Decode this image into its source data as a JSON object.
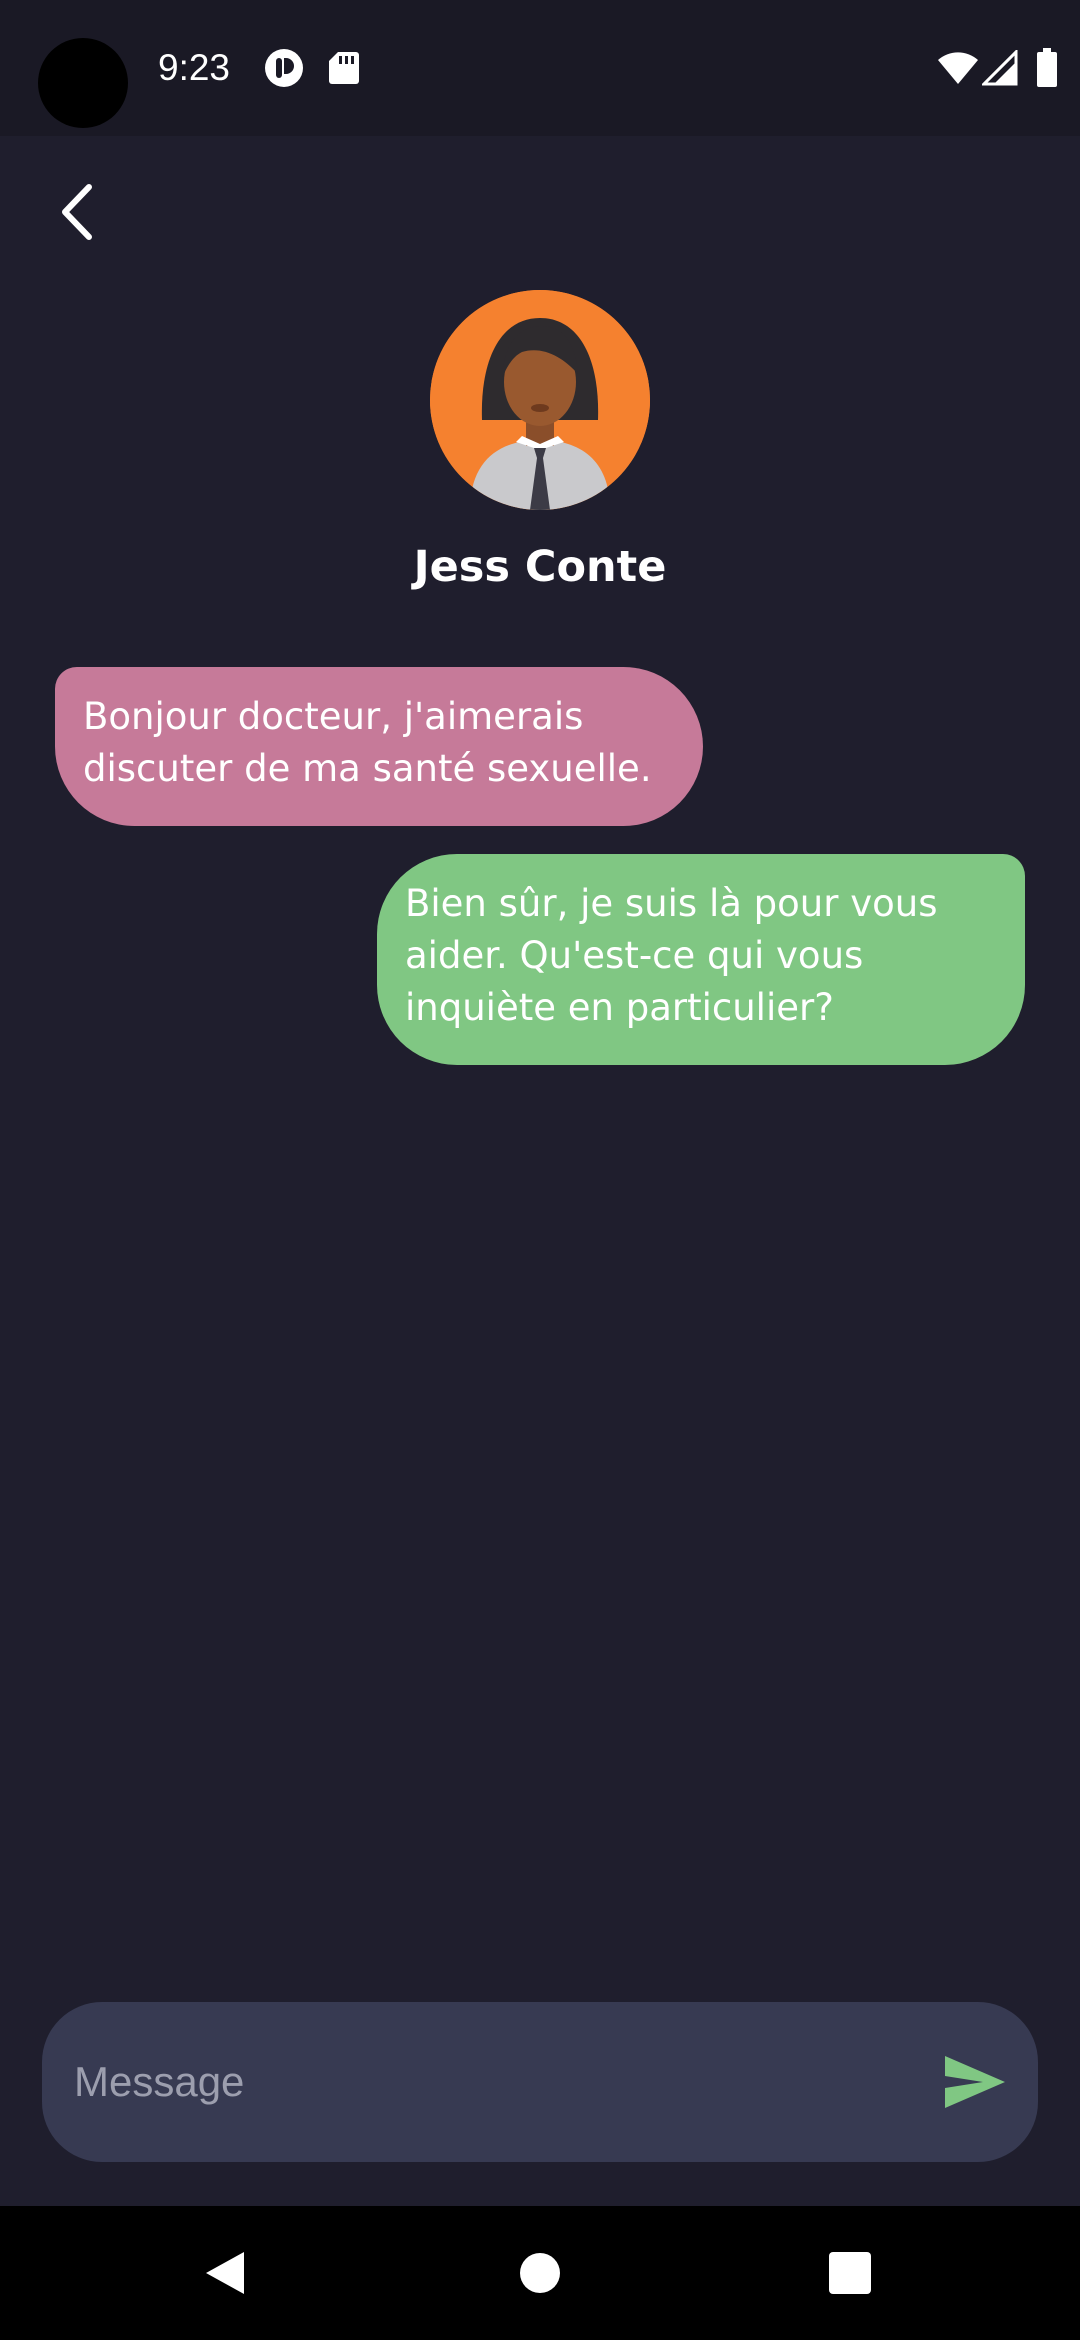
{
  "status_bar": {
    "time": "9:23",
    "left_icons": [
      "app-notification-icon",
      "sd-card-icon"
    ],
    "right_icons": [
      "wifi-icon",
      "cellular-signal-icon",
      "battery-icon"
    ]
  },
  "header": {
    "back_icon": "chevron-left-icon",
    "contact_name": "Jess Conte",
    "avatar_color": "#f5812f"
  },
  "messages": [
    {
      "direction": "incoming",
      "text": "Bonjour docteur, j'aimerais discuter de ma santé sexuelle.",
      "color": "#c67a99"
    },
    {
      "direction": "outgoing",
      "text": "Bien sûr, je suis là pour vous aider. Qu'est-ce qui vous inquiète en particulier?",
      "color": "#80c783"
    }
  ],
  "composer": {
    "placeholder": "Message",
    "value": "",
    "send_icon": "send-icon",
    "send_color": "#80c783"
  },
  "nav_bar": {
    "buttons": [
      "back-triangle-icon",
      "home-circle-icon",
      "recents-square-icon"
    ]
  },
  "theme": {
    "background": "#1f1e2d",
    "composer_background": "#373a52"
  }
}
